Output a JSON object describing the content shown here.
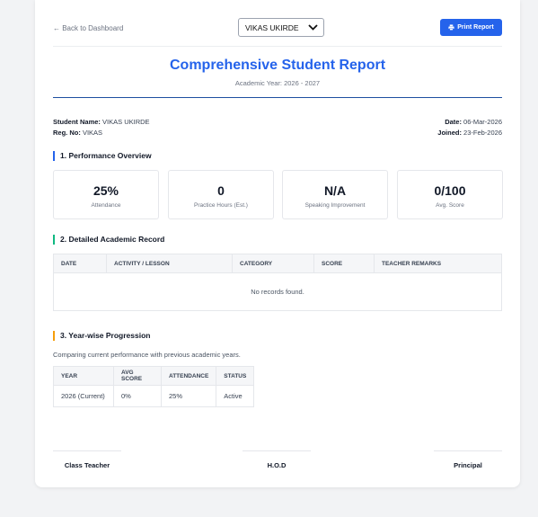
{
  "nav": {
    "back_label": "← Back to Dashboard"
  },
  "student_select": {
    "selected": "VIKAS UKIRDE"
  },
  "actions": {
    "print_label": "Print Report"
  },
  "header": {
    "title": "Comprehensive Student Report",
    "academic_year": "Academic Year: 2026 - 2027"
  },
  "student": {
    "name_label": "Student Name:",
    "name": "VIKAS UKIRDE",
    "reg_label": "Reg. No:",
    "reg": "VIKAS",
    "date_label": "Date:",
    "date": "06-Mar-2026",
    "joined_label": "Joined:",
    "joined": "23-Feb-2026"
  },
  "sections": {
    "performance": "1. Performance Overview",
    "academic": "2. Detailed Academic Record",
    "progression": "3. Year-wise Progression"
  },
  "stats": [
    {
      "value": "25%",
      "label": "Attendance"
    },
    {
      "value": "0",
      "label": "Practice Hours (Est.)"
    },
    {
      "value": "N/A",
      "label": "Speaking Improvement"
    },
    {
      "value": "0/100",
      "label": "Avg. Score"
    }
  ],
  "academic_table": {
    "headers": [
      "DATE",
      "ACTIVITY / LESSON",
      "CATEGORY",
      "SCORE",
      "TEACHER REMARKS"
    ],
    "empty_message": "No records found."
  },
  "progression": {
    "description": "Comparing current performance with previous academic years.",
    "headers": [
      "YEAR",
      "AVG SCORE",
      "ATTENDANCE",
      "STATUS"
    ],
    "rows": [
      [
        "2026 (Current)",
        "0%",
        "25%",
        "Active"
      ]
    ]
  },
  "signatures": [
    "Class Teacher",
    "H.O.D",
    "Principal"
  ],
  "colors": {
    "accent": "#2563eb",
    "section_blue": "#2563eb",
    "section_green": "#10b981",
    "section_amber": "#f59e0b"
  }
}
